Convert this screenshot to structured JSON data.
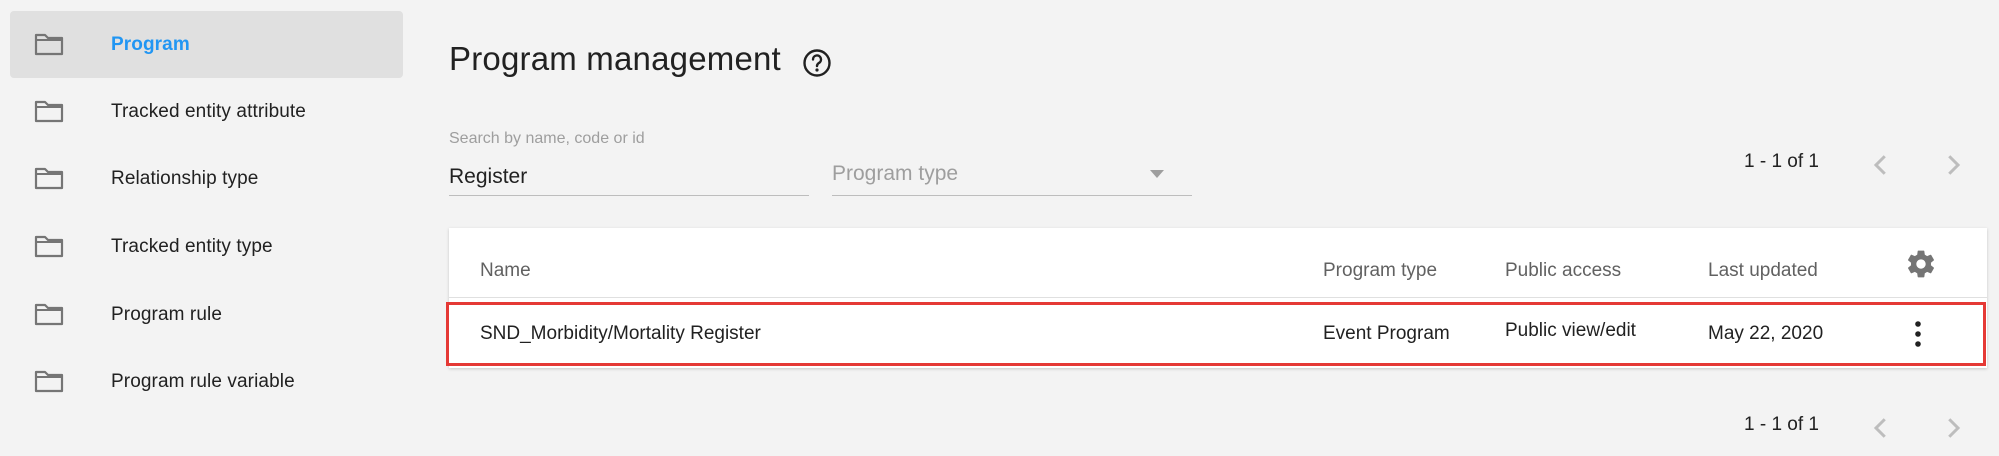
{
  "sidebar": {
    "items": [
      {
        "label": "Program",
        "active": true
      },
      {
        "label": "Tracked entity attribute"
      },
      {
        "label": "Relationship type"
      },
      {
        "label": "Tracked entity type"
      },
      {
        "label": "Program rule"
      },
      {
        "label": "Program rule variable"
      }
    ]
  },
  "header": {
    "title": "Program management",
    "help_icon": "help-circle-icon"
  },
  "filters": {
    "search": {
      "label": "Search by name, code or id",
      "value": "Register"
    },
    "program_type": {
      "placeholder": "Program type"
    }
  },
  "pagination": {
    "top": {
      "range": "1 - 1 of 1"
    },
    "bottom": {
      "range": "1 - 1 of 1"
    }
  },
  "table": {
    "columns": [
      "Name",
      "Program type",
      "Public access",
      "Last updated"
    ],
    "settings_icon": "gear-icon",
    "rows": [
      {
        "name": "SND_Morbidity/Mortality Register",
        "program_type": "Event Program",
        "public_access": "Public view/edit",
        "last_updated": "May 22, 2020",
        "menu_icon": "more-vert-icon",
        "highlighted": true
      }
    ]
  },
  "colors": {
    "accent": "#2196f3",
    "highlight_border": "#e53935",
    "background": "#f3f3f3",
    "active_item_bg": "#e0e0e0"
  }
}
